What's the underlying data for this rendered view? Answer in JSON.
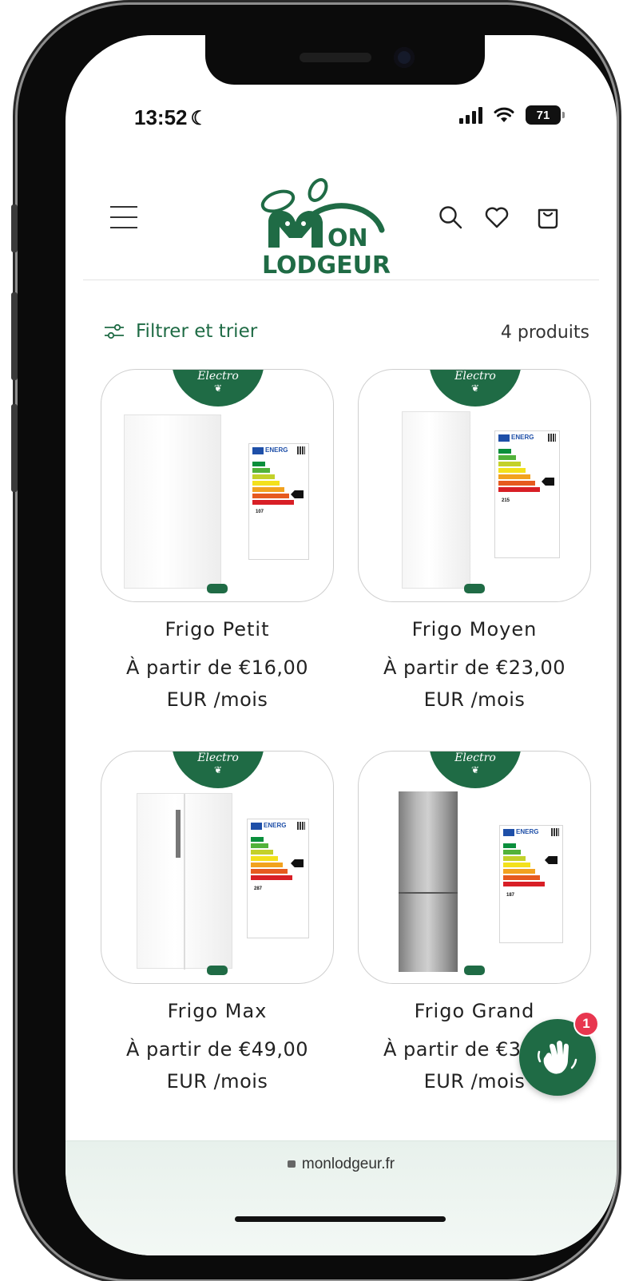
{
  "status": {
    "time": "13:52",
    "battery": "71"
  },
  "header": {
    "logo_line1": "ON",
    "logo_line2": "LODGEUR"
  },
  "filter": {
    "label": "Filtrer et trier",
    "count": "4 produits"
  },
  "badge_label": "Electro",
  "products": [
    {
      "title": "Frigo Petit",
      "price_line1": "À partir de €16,00",
      "price_line2": "EUR /mois",
      "kwh": "107",
      "energy_class": "F"
    },
    {
      "title": "Frigo Moyen",
      "price_line1": "À partir de €23,00",
      "price_line2": "EUR /mois",
      "kwh": "215",
      "energy_class": "F"
    },
    {
      "title": "Frigo Max",
      "price_line1": "À partir de €49,00",
      "price_line2": "EUR /mois",
      "kwh": "287",
      "energy_class": "E"
    },
    {
      "title": "Frigo Grand",
      "price_line1": "À partir de €38,00",
      "price_line2": "EUR /mois",
      "kwh": "187",
      "energy_class": "D"
    }
  ],
  "chat": {
    "badge_count": "1"
  },
  "browser": {
    "url": "monlodgeur.fr"
  },
  "colors": {
    "brand_green": "#1f6b45",
    "badge_red": "#e8364f"
  }
}
